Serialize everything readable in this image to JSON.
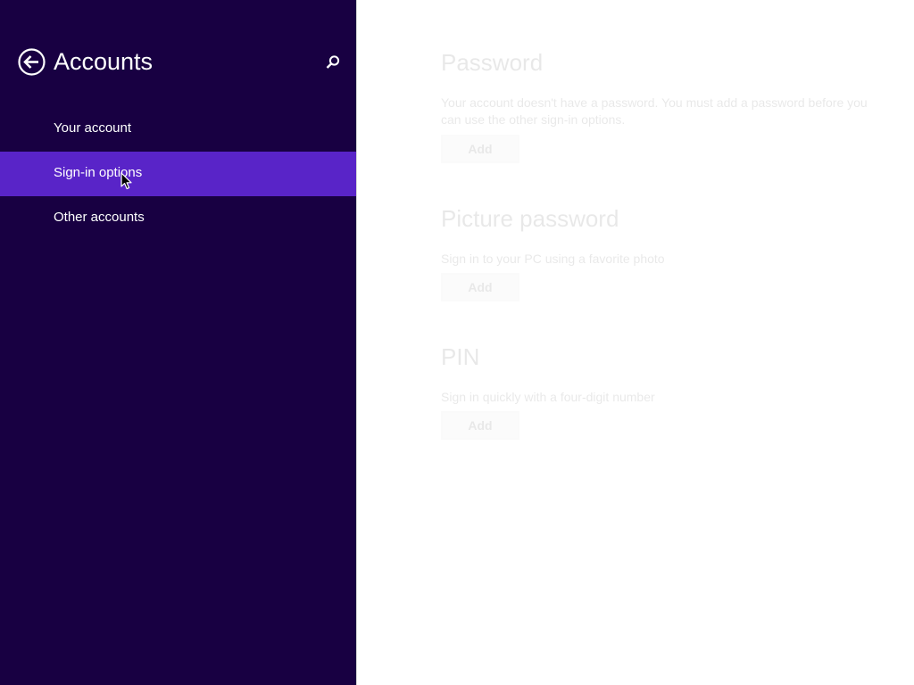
{
  "nav": {
    "title": "Accounts",
    "items": [
      {
        "label": "Your account",
        "selected": false
      },
      {
        "label": "Sign-in options",
        "selected": true
      },
      {
        "label": "Other accounts",
        "selected": false
      }
    ],
    "back_icon": "back-arrow-circle-icon",
    "search_icon": "search-icon"
  },
  "content": {
    "password": {
      "title": "Password",
      "description": "Your account doesn't have a password. You must add a password before you can use the other sign-in options.",
      "button_label": "Add"
    },
    "picture_password": {
      "title": "Picture password",
      "description": "Sign in to your PC using a favorite photo",
      "button_label": "Add"
    },
    "pin": {
      "title": "PIN",
      "description": "Sign in quickly with a four-digit number",
      "button_label": "Add"
    }
  },
  "colors": {
    "nav_background": "#180042",
    "nav_selected": "#5924c8",
    "content_background": "#ffffff"
  }
}
